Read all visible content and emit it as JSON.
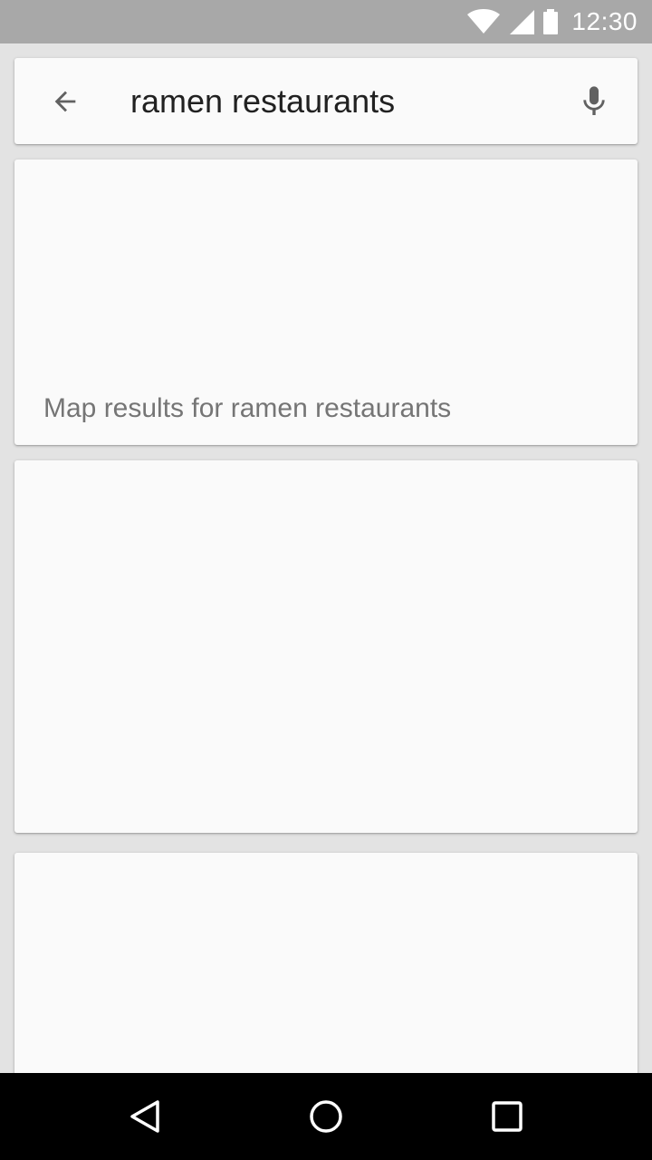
{
  "status_bar": {
    "time": "12:30",
    "icons": [
      "wifi-icon",
      "cell-signal-icon",
      "battery-icon"
    ]
  },
  "search": {
    "query": "ramen restaurants",
    "back_icon": "arrow-back-icon",
    "voice_icon": "microphone-icon"
  },
  "map_card": {
    "caption": "Map results for ramen restaurants"
  },
  "nav_bar": {
    "icons": [
      "nav-back-icon",
      "nav-home-icon",
      "nav-recents-icon"
    ]
  },
  "colors": {
    "status_bar": "#a8a8a8",
    "background": "#e3e3e3",
    "card": "#fafafa",
    "query_text": "#212121",
    "caption_text": "#757575",
    "icon": "#616161",
    "nav_bar": "#000000"
  }
}
